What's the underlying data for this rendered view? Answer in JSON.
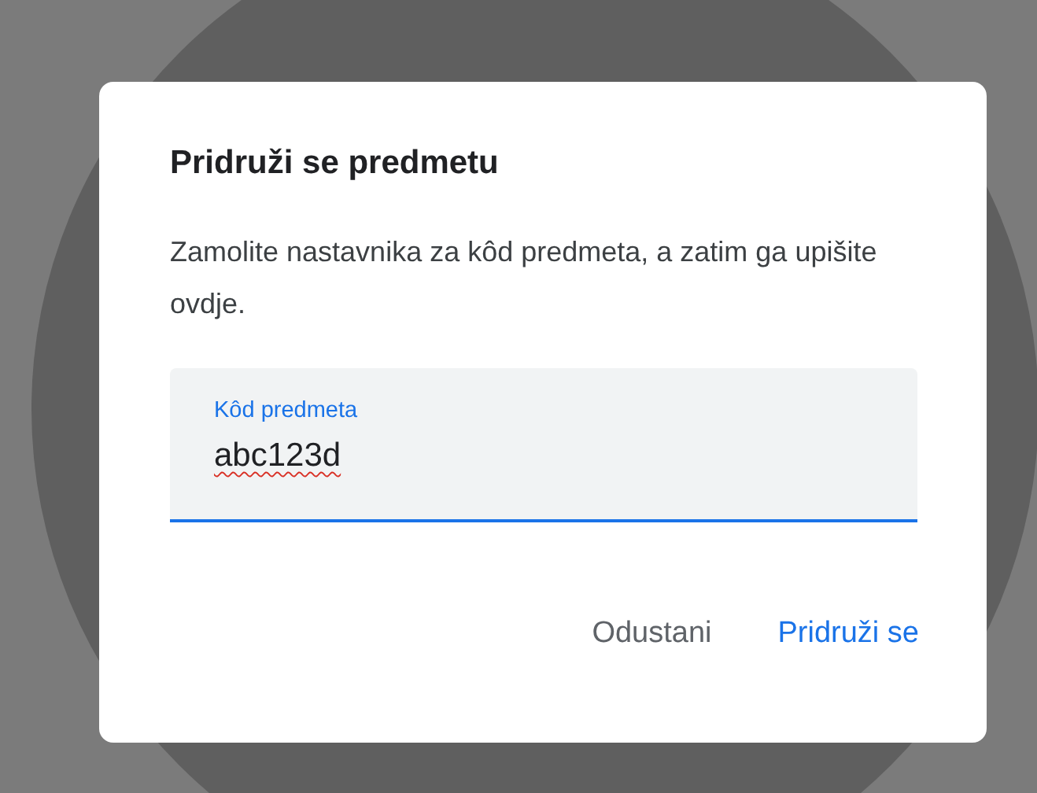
{
  "dialog": {
    "title": "Pridruži se predmetu",
    "message": "Zamolite nastavnika za kôd predmeta, a zatim ga upišite ovdje.",
    "field": {
      "label": "Kôd predmeta",
      "value": "abc123d",
      "focused": true
    },
    "buttons": [
      {
        "label": "Odustani",
        "kind": "secondary"
      },
      {
        "label": "Pridruži se",
        "kind": "primary"
      }
    ]
  }
}
